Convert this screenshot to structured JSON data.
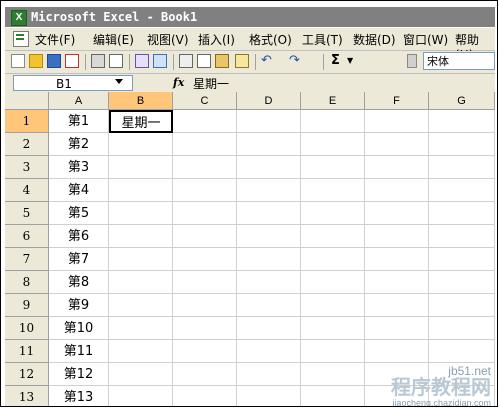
{
  "window": {
    "title": "Microsoft Excel - Book1",
    "app_icon_letter": "X"
  },
  "menu": {
    "items": [
      "文件(F)",
      "编辑(E)",
      "视图(V)",
      "插入(I)",
      "格式(O)",
      "工具(T)",
      "数据(D)",
      "窗口(W)",
      "帮助(H)"
    ]
  },
  "toolbar": {
    "sum_label": "Σ",
    "font_name": "宋体"
  },
  "formula_bar": {
    "name_box": "B1",
    "fx_label": "fx",
    "formula": "星期一"
  },
  "sheet": {
    "columns": [
      "A",
      "B",
      "C",
      "D",
      "E",
      "F",
      "G"
    ],
    "active_column": "B",
    "active_row": "1",
    "rows": [
      {
        "num": "1",
        "A": "第1",
        "B": "星期一"
      },
      {
        "num": "2",
        "A": "第2",
        "B": ""
      },
      {
        "num": "3",
        "A": "第3",
        "B": ""
      },
      {
        "num": "4",
        "A": "第4",
        "B": ""
      },
      {
        "num": "5",
        "A": "第5",
        "B": ""
      },
      {
        "num": "6",
        "A": "第6",
        "B": ""
      },
      {
        "num": "7",
        "A": "第7",
        "B": ""
      },
      {
        "num": "8",
        "A": "第8",
        "B": ""
      },
      {
        "num": "9",
        "A": "第9",
        "B": ""
      },
      {
        "num": "10",
        "A": "第10",
        "B": ""
      },
      {
        "num": "11",
        "A": "第11",
        "B": ""
      },
      {
        "num": "12",
        "A": "第12",
        "B": ""
      },
      {
        "num": "13",
        "A": "第13",
        "B": ""
      }
    ]
  },
  "watermark": {
    "line1": "jb51.net",
    "line2": "程序教程网",
    "line3": "jiaocheng.chazidian.com"
  }
}
